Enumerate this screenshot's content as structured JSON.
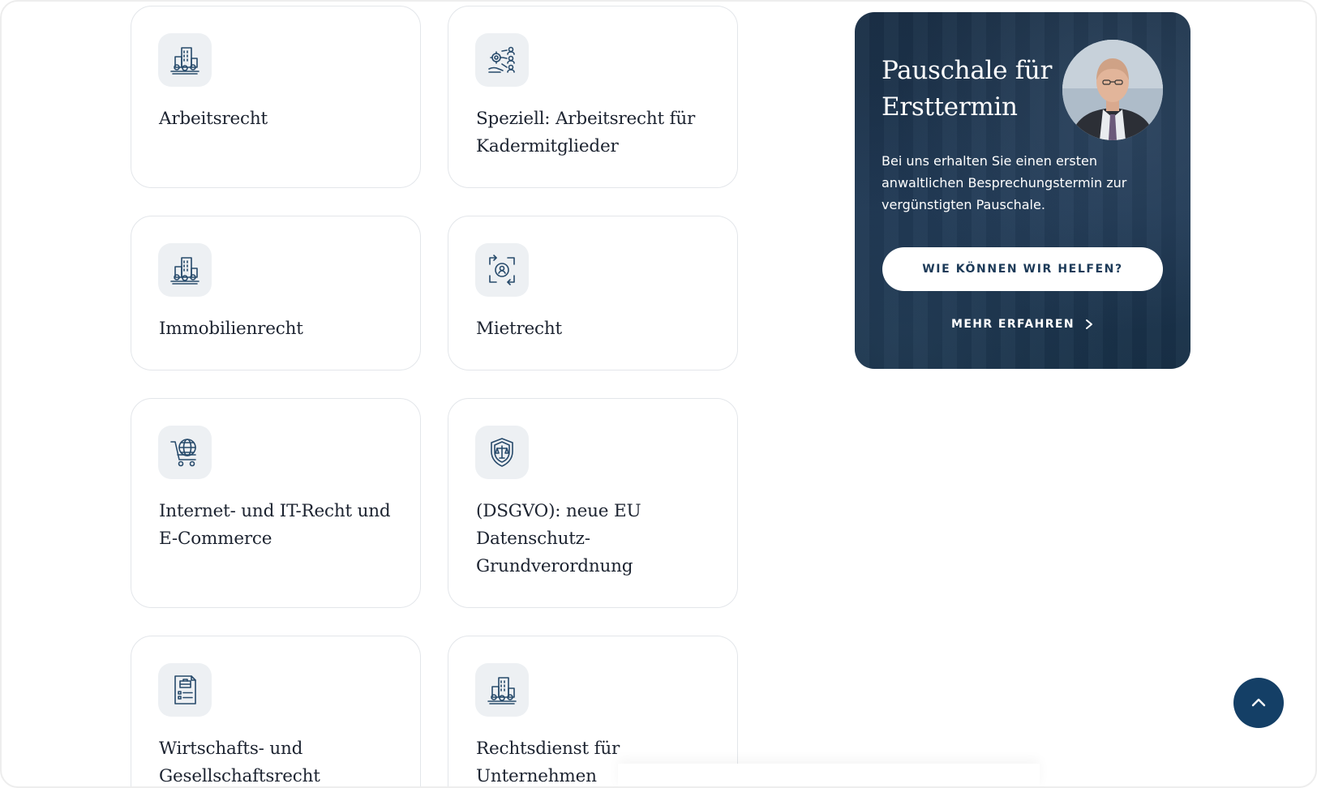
{
  "services": [
    {
      "label": "Arbeitsrecht",
      "icon": "city-buildings-icon"
    },
    {
      "label": "Speziell: Arbeitsrecht für Kadermitglieder",
      "icon": "team-network-icon"
    },
    {
      "label": "Immobilienrecht",
      "icon": "city-buildings-icon"
    },
    {
      "label": "Mietrecht",
      "icon": "tenant-cycle-icon"
    },
    {
      "label": "Internet- und IT-Recht und E-Commerce",
      "icon": "globe-cart-icon"
    },
    {
      "label": "(DSGVO): neue EU Datenschutz-Grundverordnung",
      "icon": "shield-scales-icon"
    },
    {
      "label": "Wirtschafts- und Gesellschaftsrecht",
      "icon": "document-briefcase-icon"
    },
    {
      "label": "Rechtsdienst für Unternehmen",
      "icon": "city-buildings-icon"
    }
  ],
  "promo": {
    "title": "Pauschale für Ersttermin",
    "description": "Bei uns erhalten Sie einen ersten anwaltlichen Besprechungstermin zur vergünstigten Pauschale.",
    "cta_label": "WIE KÖNNEN WIR HELFEN?",
    "more_label": "MEHR ERFAHREN"
  },
  "colors": {
    "accent": "#143f66",
    "promo_bg": "#1b3047",
    "icon_stroke": "#274a6b",
    "icon_tile": "#edf0f3"
  },
  "scroll_top_icon": "chevron-up-icon"
}
